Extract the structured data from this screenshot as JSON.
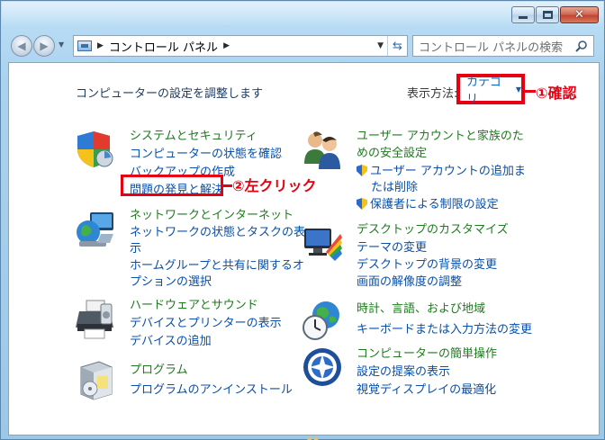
{
  "window": {
    "min_label": "",
    "max_label": "",
    "close_label": "✕"
  },
  "address": {
    "path": "コントロール パネル"
  },
  "search": {
    "placeholder": "コントロール パネルの検索"
  },
  "content": {
    "title": "コンピューターの設定を調整します",
    "view_label": "表示方法:",
    "view_value": "カテゴリ",
    "annotation1": "①確認",
    "annotation2": "②左クリック"
  },
  "categories": [
    {
      "title": "システムとセキュリティ",
      "links": [
        "コンピューターの状態を確認",
        "バックアップの作成",
        "問題の発見と解決"
      ]
    },
    {
      "title": "ネットワークとインターネット",
      "links": [
        "ネットワークの状態とタスクの表",
        "示",
        "ホームグループと共有に関するオ",
        "プションの選択"
      ]
    },
    {
      "title": "ハードウェアとサウンド",
      "links": [
        "デバイスとプリンターの表示",
        "デバイスの追加"
      ]
    },
    {
      "title": "プログラム",
      "links": [
        "プログラムのアンインストール"
      ]
    },
    {
      "title": "ユーザー アカウントと家族のた",
      "title2": "めの安全設定",
      "links": [
        "ユーザー アカウントの追加ま",
        "たは削除",
        "保護者による制限の設定"
      ]
    },
    {
      "title": "デスクトップのカスタマイズ",
      "links": [
        "テーマの変更",
        "デスクトップの背景の変更",
        "画面の解像度の調整"
      ]
    },
    {
      "title": "時計、言語、および地域",
      "links": [
        "キーボードまたは入力方法の変更"
      ]
    },
    {
      "title": "コンピューターの簡単操作",
      "links": [
        "設定の提案の表示",
        "視覚ディスプレイの最適化"
      ]
    }
  ],
  "icons": {
    "security": "shield-icon",
    "network": "network-globe-icon",
    "hardware": "printer-icon",
    "programs": "programs-box-icon",
    "users": "users-icon",
    "desktop": "monitor-paint-icon",
    "clock": "clock-globe-icon",
    "ease": "ease-of-access-icon"
  },
  "colors": {
    "category_title": "#1f7a1f",
    "link": "#0a4fa8",
    "annotation": "#e60012"
  }
}
